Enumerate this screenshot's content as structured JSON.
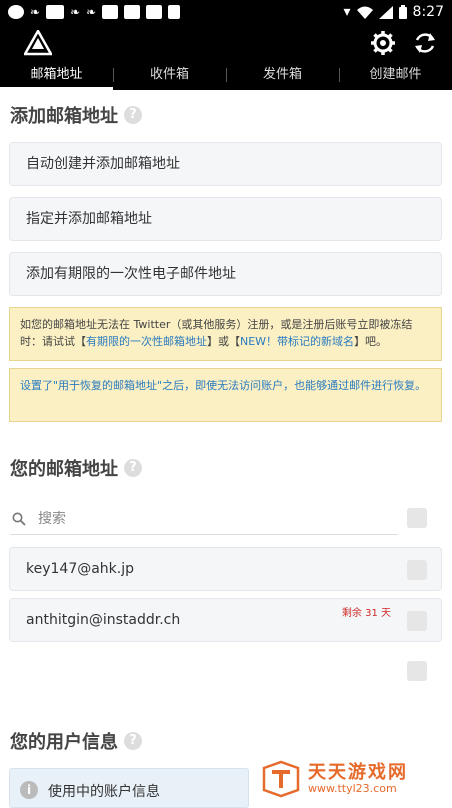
{
  "status_bar": {
    "time": "8:27",
    "icons": [
      "app-icon",
      "chinese-app-icon",
      "news-icon",
      "chinese-app-icon",
      "chinese-app-icon",
      "square-icon",
      "square-icon",
      "square-icon",
      "a-icon",
      "location-icon",
      "wifi-icon",
      "signal-icon",
      "battery-icon"
    ]
  },
  "app_bar": {
    "icons": [
      "recycle-logo-icon",
      "gear-icon",
      "refresh-icon"
    ]
  },
  "tabs": [
    {
      "label": "邮箱地址",
      "active": true
    },
    {
      "label": "收件箱",
      "active": false
    },
    {
      "label": "发件箱",
      "active": false
    },
    {
      "label": "创建邮件",
      "active": false
    }
  ],
  "add_section": {
    "title": "添加邮箱地址",
    "help": "?",
    "buttons": [
      "自动创建并添加邮箱地址",
      "指定并添加邮箱地址",
      "添加有期限的一次性电子邮件地址"
    ]
  },
  "notices": {
    "twitter": {
      "line1": "如您的邮箱地址无法在 Twitter（或其他服务）注册，或是注册后账号立即被冻结",
      "line2_prefix": "时：请试试【",
      "link1": "有期限的一次性邮箱地址",
      "mid": "】或【",
      "link2": "NEW！带标记的新域名",
      "suffix": "】吧。"
    },
    "recovery": {
      "text": "设置了\"用于恢复的邮箱地址\"之后，即使无法访问账户，也能够通过邮件进行恢复。"
    }
  },
  "addresses_section": {
    "title": "您的邮箱地址",
    "help": "?",
    "search_placeholder": "搜索",
    "items": [
      {
        "address": "key147@ahk.jp",
        "expiry": ""
      },
      {
        "address": "anthitgin@instaddr.ch",
        "expiry": "剩余 31 天"
      }
    ]
  },
  "user_section": {
    "title": "您的用户信息",
    "help": "?",
    "account_info_label": "使用中的账户信息",
    "info_icon": "i"
  },
  "watermark": {
    "title": "天天游戏网",
    "url": "www.ttyl23.com"
  },
  "colors": {
    "bar_bg": "#000000",
    "notice_bg": "#fbf0c4",
    "link": "#2a7bc0",
    "expiry": "#d02a2a",
    "watermark": "#e66a2c"
  }
}
